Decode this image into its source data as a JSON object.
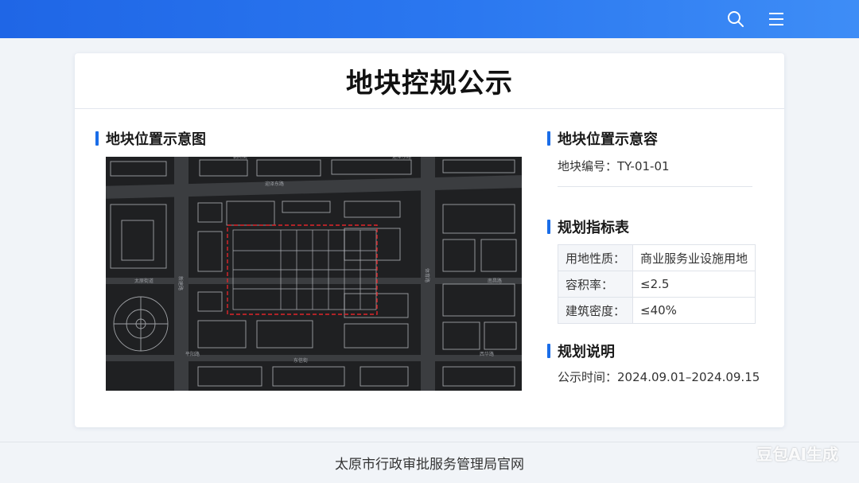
{
  "header": {
    "search_icon": "search-icon",
    "menu_icon": "menu-icon",
    "accent_color": "#1f66e6"
  },
  "card": {
    "title": "地块控规公示"
  },
  "location_map": {
    "heading": "地块位置示意图",
    "street_labels": [
      "迎泽东路",
      "太原街道",
      "东信街",
      "南昌路",
      "迎泽东路",
      "新建路",
      "体育路",
      "平阳路",
      "西华路",
      "朝阳街"
    ]
  },
  "location_info": {
    "heading": "地块位置示意容",
    "parcel_label": "地块编号：",
    "parcel_value": "TY-01-01"
  },
  "indicators": {
    "heading": "规划指标表",
    "rows": [
      {
        "key": "用地性质：",
        "value": "商业服务业设施用地"
      },
      {
        "key": "容积率：",
        "value": "≤2.5"
      },
      {
        "key": "建筑密度：",
        "value": "≤40%"
      }
    ]
  },
  "notes": {
    "heading": "规划说明",
    "time_label": "公示时间：",
    "time_value": "2024.09.01–2024.09.15"
  },
  "footer": {
    "text": "太原市行政审批服务管理局官网"
  },
  "watermark": {
    "text": "豆包AI生成"
  }
}
